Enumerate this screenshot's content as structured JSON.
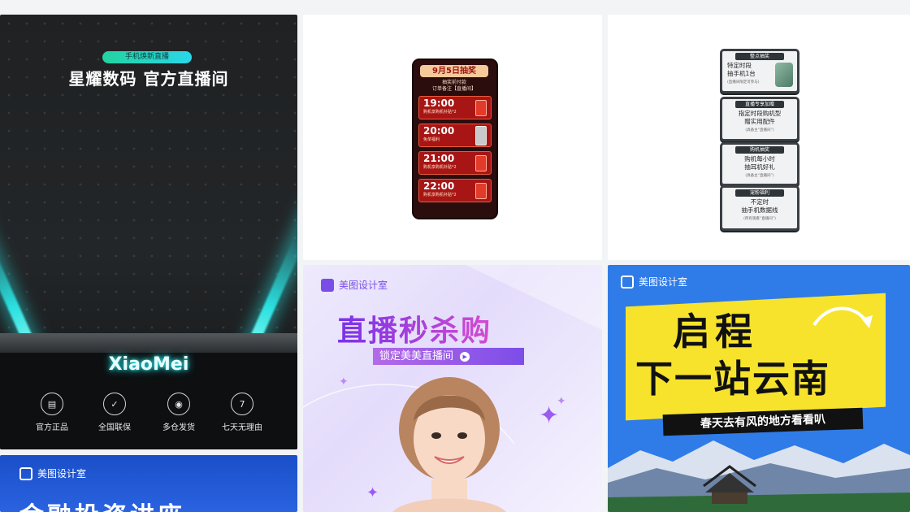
{
  "cards": {
    "live_studio": {
      "pill": "手机焕新直播",
      "title": "星耀数码 官方直播间",
      "brand": "XiaoMei",
      "features": [
        {
          "icon": "shop-icon",
          "label": "官方正品"
        },
        {
          "icon": "shield-icon",
          "label": "全国联保"
        },
        {
          "icon": "location-icon",
          "label": "多仓发货"
        },
        {
          "icon": "seven-days-icon",
          "label": "七天无理由"
        }
      ]
    },
    "lottery": {
      "header": "9月5日抽奖",
      "subtitle_1": "抽奖前付款",
      "subtitle_2": "订单备注【直播间】",
      "slots": [
        {
          "time": "19:00",
          "desc": "购机享购机补贴*2"
        },
        {
          "time": "20:00",
          "desc": "免单福利"
        },
        {
          "time": "21:00",
          "desc": "购机享购机补贴*2"
        },
        {
          "time": "22:00",
          "desc": "购机享购机补贴*2"
        }
      ]
    },
    "benefits": [
      {
        "head": "整点抽奖",
        "text": "特定时段\n抽手机1台",
        "note": "(直播间限定可参与)"
      },
      {
        "head": "直播专享加赠",
        "text": "指定时段购机型\n赠实用配件",
        "note": "(具备主“直播间”)"
      },
      {
        "head": "购机抽奖",
        "text": "购机每小时\n抽耳机好礼",
        "note": "(具备主“直播间”)"
      },
      {
        "head": "宠粉福利",
        "text": "不定时\n抽手机数据线",
        "note": "(所有观看“直播间”)"
      }
    ],
    "flash_sale": {
      "logo": "美图设计室",
      "title": "直播秒杀购",
      "bar": "锁定美美直播间"
    },
    "travel": {
      "logo": "美图设计室",
      "line1": "启程",
      "line2": "下一站云南",
      "tagline": "春天去有风的地方看看叭"
    },
    "finance": {
      "logo": "美图设计室",
      "title": "金融投资讲座"
    }
  },
  "colors": {
    "neon": "#2be0e0",
    "lottery_red": "#a81515",
    "flash_purple": "#7a33e8",
    "travel_yellow": "#f7e32c",
    "travel_blue": "#2f7be8",
    "finance_blue": "#1a4fc8"
  }
}
